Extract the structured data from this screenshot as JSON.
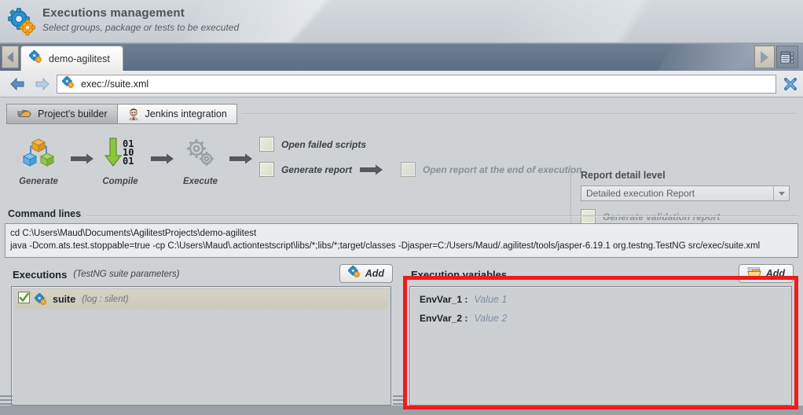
{
  "header": {
    "title": "Executions management",
    "subtitle": "Select groups, package or tests to be executed",
    "icon": "gears-blue-orange-icon"
  },
  "tabstrip": {
    "project_tab_label": "demo-agilitest",
    "project_tab_icon": "gears-blue-orange-icon",
    "left_nav_icon": "triangle-left-icon",
    "right_nav_icon": "triangle-right-icon",
    "list_icon": "tab-list-icon"
  },
  "addressbar": {
    "back_icon": "arrow-back-icon",
    "forward_icon": "arrow-forward-icon",
    "url_icon": "gears-blue-orange-icon",
    "url": "exec://suite.xml",
    "close_icon": "close-cross-icon"
  },
  "subtabs": [
    {
      "label": "Project's builder",
      "icon": "builder-icon",
      "active": true
    },
    {
      "label": "Jenkins integration",
      "icon": "jenkins-butler-icon",
      "active": false
    }
  ],
  "pipeline": {
    "steps": [
      {
        "label": "Generate",
        "icon": "cubes-generate-icon"
      },
      {
        "label": "Compile",
        "icon": "binary-arrow-compile-icon"
      },
      {
        "label": "Execute",
        "icon": "gears-execute-icon"
      }
    ],
    "arrow_icon": "arrow-right-icon",
    "options": [
      {
        "label": "Open failed scripts",
        "checked": false,
        "dim": false
      },
      {
        "label": "Generate report",
        "checked": false,
        "dim": false
      },
      {
        "label": "Open  report at the end of execution",
        "checked": false,
        "dim": true
      }
    ]
  },
  "report_detail": {
    "title": "Report detail level",
    "selected": "Detailed execution Report",
    "dropdown_icon": "chevron-down-icon",
    "validation_label": "Generate validation report",
    "validation_checked": false
  },
  "command_lines": {
    "legend": "Command lines",
    "lines": [
      "cd C:\\Users\\Maud\\Documents\\AgilitestProjects\\demo-agilitest",
      "java -Dcom.ats.test.stoppable=true -cp C:\\Users\\Maud\\.actiontestscript\\libs/*;libs/*;target/classes -Djasper=C:/Users/Maud/.agilitest/tools/jasper-6.19.1 org.testng.TestNG src/exec/suite.xml"
    ]
  },
  "executions_panel": {
    "title": "Executions",
    "subtitle": "(TestNG suite parameters)",
    "add_label": "Add",
    "add_icon": "gears-blue-orange-icon",
    "rows": [
      {
        "name": "suite",
        "meta": "(log : silent)",
        "checked": true,
        "check_icon": "checkbox-checked-icon",
        "icon": "gears-blue-orange-icon"
      }
    ]
  },
  "execution_variables_panel": {
    "title": "Execution variables",
    "add_label": "Add",
    "add_icon": "drawer-open-icon",
    "highlight_color": "#ee1c1c",
    "rows": [
      {
        "key": "EnvVar_1 :",
        "value": "Value 1"
      },
      {
        "key": "EnvVar_2 :",
        "value": "Value 2"
      }
    ]
  }
}
